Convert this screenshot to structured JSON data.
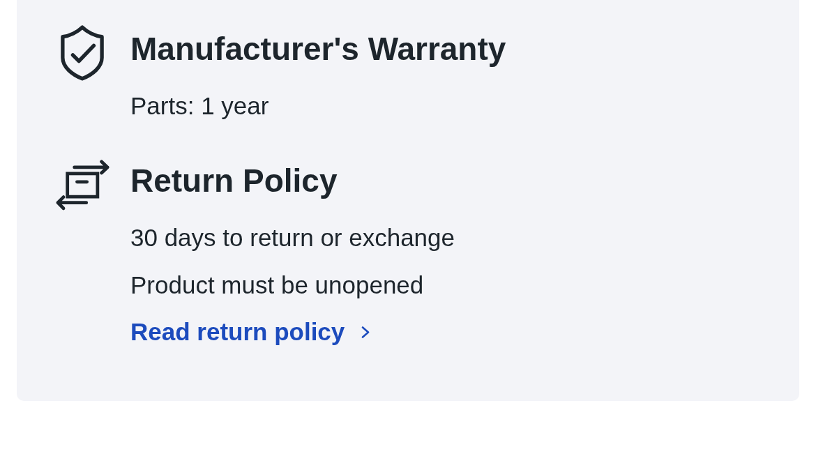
{
  "sections": [
    {
      "kind": "warranty",
      "title": "Manufacturer's Warranty",
      "lines": [
        "Parts: 1 year"
      ]
    },
    {
      "kind": "return",
      "title": "Return Policy",
      "lines": [
        "30 days to return or exchange",
        "Product must be unopened"
      ],
      "link": {
        "label": "Read return policy"
      }
    }
  ]
}
